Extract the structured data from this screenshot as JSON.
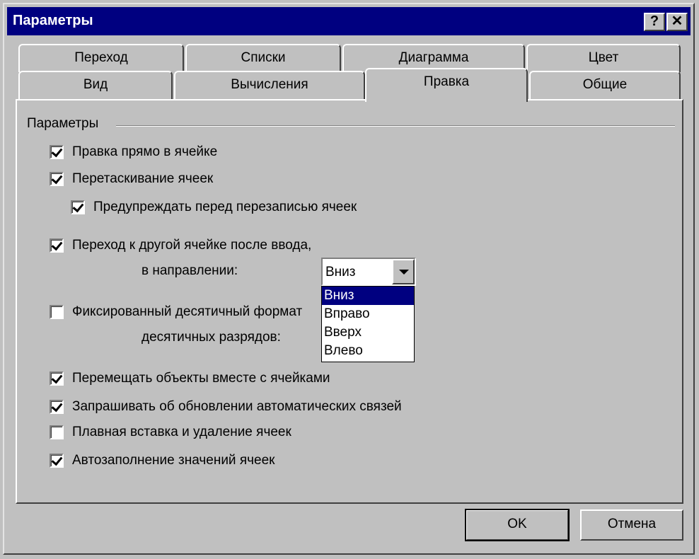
{
  "window": {
    "title": "Параметры",
    "help_label": "?",
    "close_label": "✕"
  },
  "tabs": {
    "row1": [
      "Переход",
      "Списки",
      "Диаграмма",
      "Цвет"
    ],
    "row2": [
      "Вид",
      "Вычисления",
      "Правка",
      "Общие"
    ],
    "active": "Правка"
  },
  "group": {
    "label": "Параметры"
  },
  "options": {
    "edit_in_cell": {
      "label": "Правка прямо в ячейке",
      "checked": true
    },
    "drag_cells": {
      "label": "Перетаскивание ячеек",
      "checked": true
    },
    "warn_overwrite": {
      "label": "Предупреждать перед перезаписью ячеек",
      "checked": true
    },
    "move_after_enter": {
      "label": "Переход к другой ячейке после ввода,",
      "checked": true
    },
    "direction_label": "в направлении:",
    "fixed_decimal": {
      "label": "Фиксированный десятичный формат",
      "checked": false
    },
    "decimal_places_label": "десятичных разрядов:",
    "cut_copy_objects": {
      "label": "Перемещать объекты вместе с ячейками",
      "checked": true
    },
    "ask_update_links": {
      "label": "Запрашивать об обновлении автоматических связей",
      "checked": true
    },
    "animate_insert": {
      "label": "Плавная вставка и удаление ячеек",
      "checked": false
    },
    "autocomplete": {
      "label": "Автозаполнение значений ячеек",
      "checked": true
    }
  },
  "direction_combo": {
    "value": "Вниз",
    "options": [
      "Вниз",
      "Вправо",
      "Вверх",
      "Влево"
    ],
    "highlighted": "Вниз"
  },
  "buttons": {
    "ok": "OK",
    "cancel": "Отмена"
  }
}
